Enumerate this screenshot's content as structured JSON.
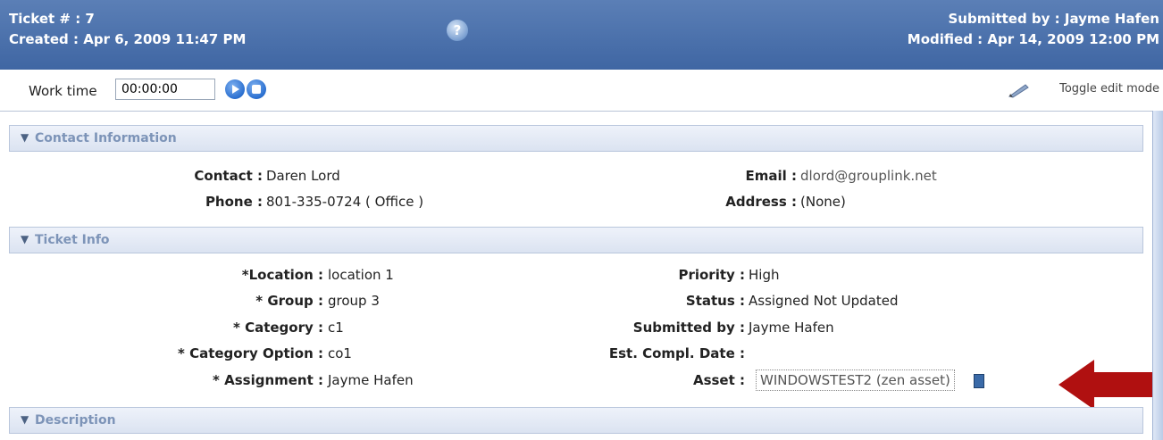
{
  "header": {
    "ticket_number": "Ticket # : 7",
    "created": "Created : Apr 6, 2009 11:47 PM",
    "submitted_by": "Submitted by : Jayme Hafen",
    "modified": "Modified : Apr 14, 2009 12:00 PM",
    "help_icon": "help-question-icon"
  },
  "toolbar": {
    "work_time_label": "Work time",
    "work_time_value": "00:00:00",
    "play_icon": "play-icon",
    "stop_icon": "stop-icon",
    "toggle_edit_label": "Toggle edit mode",
    "toggle_edit_icon": "pencil-icon"
  },
  "sections": {
    "contact": "Contact Information",
    "ticket": "Ticket Info",
    "description": "Description"
  },
  "contact": {
    "contact_label": "Contact :",
    "contact_value": "Daren Lord",
    "phone_label": "Phone :",
    "phone_value": "801-335-0724  ( Office )",
    "email_label": "Email :",
    "email_value": "dlord@grouplink.net",
    "address_label": "Address :",
    "address_value": "(None)"
  },
  "ticket_info": {
    "location_label": "*Location :",
    "location_value": "location 1",
    "group_label": "* Group :",
    "group_value": "group 3",
    "category_label": "* Category :",
    "category_value": "c1",
    "category_option_label": "* Category Option :",
    "category_option_value": "co1",
    "assignment_label": "* Assignment :",
    "assignment_value": "Jayme Hafen",
    "priority_label": "Priority :",
    "priority_value": "High",
    "status_label": "Status :",
    "status_value": "Assigned Not Updated",
    "submitted_by_label": "Submitted by :",
    "submitted_by_value": "Jayme Hafen",
    "est_compl_label": "Est. Compl. Date :",
    "est_compl_value": "",
    "asset_label": "Asset :",
    "asset_value": "WINDOWSTEST2 (zen asset)",
    "asset_icon": "asset-icon"
  },
  "annotation": {
    "arrow_color": "#b01010"
  }
}
